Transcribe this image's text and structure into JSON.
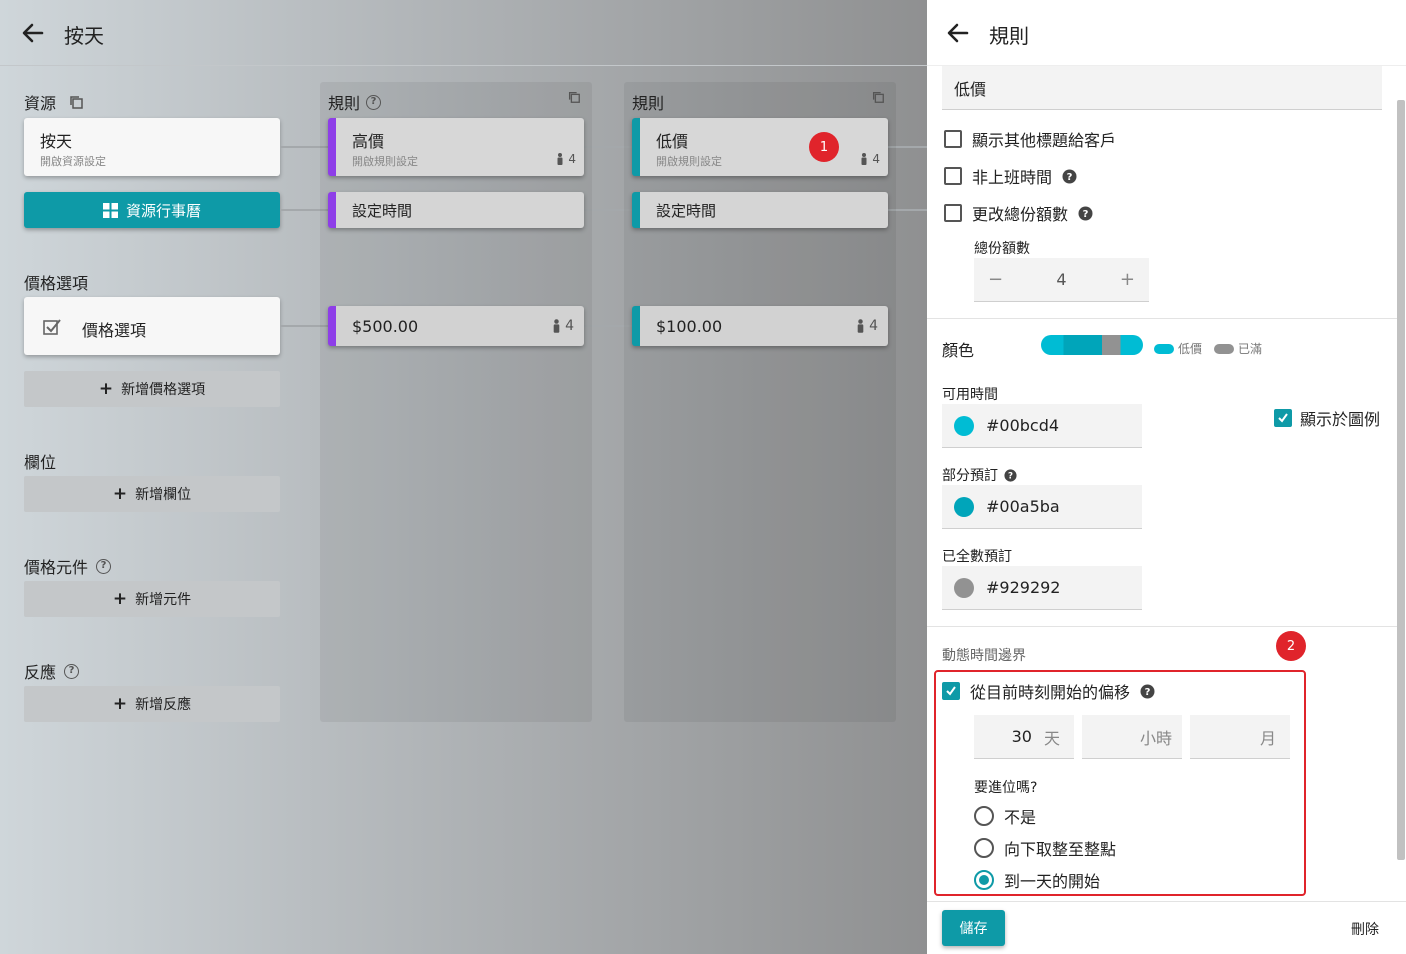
{
  "left": {
    "header": {
      "title": "按天"
    },
    "resource": {
      "section_title": "資源",
      "card_title": "按天",
      "card_subtitle": "開啟資源設定",
      "calendar_button": "資源行事曆"
    },
    "price_options": {
      "section_title": "價格選項",
      "item_label": "價格選項",
      "add_label": "新增價格選項"
    },
    "fields": {
      "section_title": "欄位",
      "add_label": "新增欄位"
    },
    "price_components": {
      "section_title": "價格元件",
      "add_label": "新增元件"
    },
    "reactions": {
      "section_title": "反應",
      "add_label": "新增反應"
    },
    "columns": [
      {
        "header": "規則",
        "rule_title": "高價",
        "rule_subtitle": "開啟規則設定",
        "count": "4",
        "time_label": "設定時間",
        "price": "$500.00",
        "price_count": "4",
        "accent": "#8e3ee8"
      },
      {
        "header": "規則",
        "rule_title": "低價",
        "rule_subtitle": "開啟規則設定",
        "count": "4",
        "time_label": "設定時間",
        "price": "$100.00",
        "price_count": "4",
        "accent": "#0e9aa7"
      }
    ],
    "badge_1": "1"
  },
  "panel": {
    "header": {
      "title": "規則"
    },
    "name_value": "低價",
    "checkboxes": {
      "show_other_titles": {
        "label": "顯示其他標題給客戶",
        "checked": false
      },
      "non_working_hours": {
        "label": "非上班時間",
        "checked": false
      },
      "change_total_quota": {
        "label": "更改總份額數",
        "checked": false
      }
    },
    "total_quota": {
      "label": "總份額數",
      "value": "4",
      "minus": "−",
      "plus": "+"
    },
    "color": {
      "label": "顏色",
      "legend_low": "低價",
      "legend_full": "已滿"
    },
    "available_time": {
      "label": "可用時間",
      "value": "#00bcd4"
    },
    "show_in_legend": {
      "label": "顯示於圖例",
      "checked": true
    },
    "partial_booking": {
      "label": "部分預訂",
      "value": "#00a5ba"
    },
    "fully_booked": {
      "label": "已全數預訂",
      "value": "#929292"
    },
    "dynamic_boundary": {
      "label": "動態時間邊界"
    },
    "badge_2": "2",
    "offset": {
      "label": "從目前時刻開始的偏移",
      "checked": true,
      "days_value": "30",
      "days_unit": "天",
      "hours_unit": "小時",
      "months_unit": "月"
    },
    "round": {
      "question": "要進位嗎?",
      "options": [
        {
          "label": "不是",
          "selected": false
        },
        {
          "label": "向下取整至整點",
          "selected": false
        },
        {
          "label": "到一天的開始",
          "selected": true
        }
      ]
    },
    "save_label": "儲存",
    "delete_label": "刪除"
  },
  "colors": {
    "teal": "#0e9aa7",
    "purple": "#8e3ee8",
    "cyan": "#00bcd4",
    "cyan_dark": "#00a5ba",
    "grey": "#929292",
    "red": "#e0242b"
  }
}
